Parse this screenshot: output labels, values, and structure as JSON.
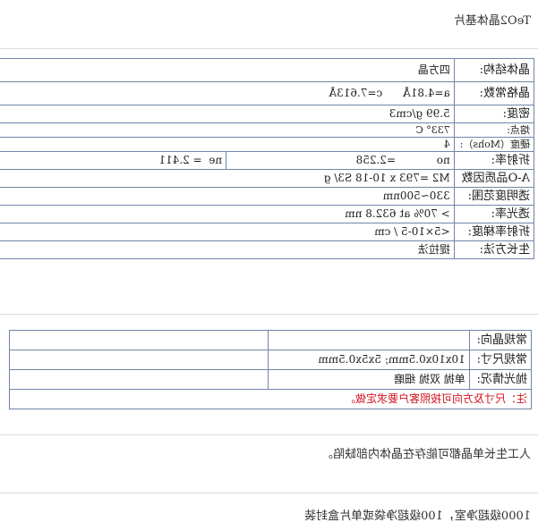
{
  "title": "TeO2晶体基片",
  "properties": [
    {
      "label": "晶体结构:",
      "values": [
        "四方晶"
      ]
    },
    {
      "label": "晶格常数:",
      "values": [
        "a=4.81Å",
        "c=7.613Å"
      ]
    },
    {
      "label": "密度:",
      "values": [
        "5.99 g/cm3"
      ]
    },
    {
      "label": "熔点:",
      "values": [
        "733° C"
      ]
    },
    {
      "label": "硬度（Mohs）:",
      "values": [
        "4"
      ]
    },
    {
      "label": "折射率:",
      "values": [
        "no",
        "=2.258",
        "ne",
        "= 2.411"
      ]
    },
    {
      "label": "A-O品质因数",
      "values": [
        "M2 =793 x 10-18 S3/ g"
      ]
    },
    {
      "label": "透明度范围:",
      "values": [
        "330~500nm"
      ]
    },
    {
      "label": "透光率:",
      "values": [
        "> 70% at 632.8 nm"
      ]
    },
    {
      "label": "折射率梯度:",
      "values": [
        "<5×10-5 / cm"
      ]
    },
    {
      "label": "生长方法:",
      "values": [
        "提拉法"
      ]
    }
  ],
  "spec": [
    {
      "label": "常规晶向:",
      "value": ""
    },
    {
      "label": "常规尺寸:",
      "value": "10x10x0.5mm; 5x5x0.5mm"
    },
    {
      "label": "抛光情况:",
      "value": "单抛  双抛  细磨"
    }
  ],
  "spec_note": "注：尺寸及方向可按照客户要求定做。",
  "para1": "人工生长单晶都可能存在晶体内部缺陷。",
  "para2": "1000级超净室，100级超净袋或单片盒封装"
}
